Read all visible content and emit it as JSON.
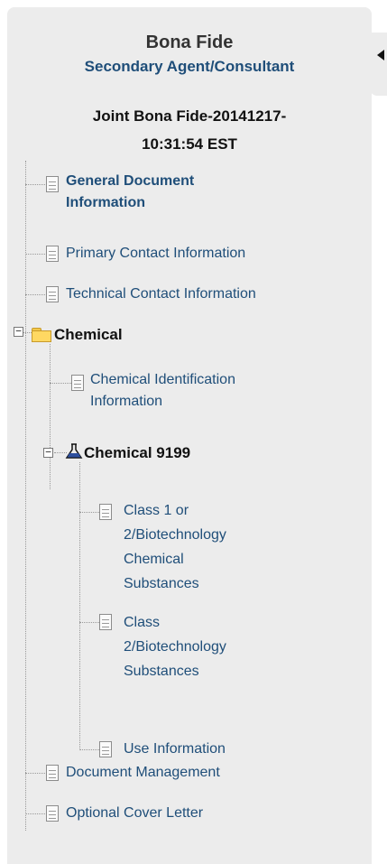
{
  "header": {
    "title": "Bona Fide",
    "subtitle": "Secondary Agent/Consultant",
    "document_name_line1": "Joint Bona Fide-20141217-",
    "document_name_line2": "10:31:54 EST"
  },
  "tree": {
    "general_document_information": [
      "General Document",
      "Information"
    ],
    "primary_contact_information": "Primary Contact Information",
    "technical_contact_information": "Technical Contact Information",
    "chemical": {
      "label": "Chemical",
      "toggle": "−",
      "chemical_identification_information": [
        "Chemical Identification",
        "Information"
      ],
      "chemical_9199": {
        "label": "Chemical 9199",
        "toggle": "−",
        "class_1_or_2": [
          "Class 1 or",
          "2/Biotechnology",
          "Chemical",
          "Substances"
        ],
        "class_2": [
          "Class",
          "2/Biotechnology",
          "Substances"
        ],
        "use_information": "Use Information"
      }
    },
    "document_management": "Document Management",
    "optional_cover_letter": "Optional Cover Letter"
  },
  "icons": {
    "document": "document-icon",
    "folder": "folder-icon",
    "flask": "flask-icon",
    "collapse": "collapse-arrow-icon"
  },
  "colors": {
    "panel_bg": "#ececec",
    "link_blue": "#1f4e79",
    "folder_yellow": "#ffd862",
    "flask_blue": "#2d4f9e"
  }
}
